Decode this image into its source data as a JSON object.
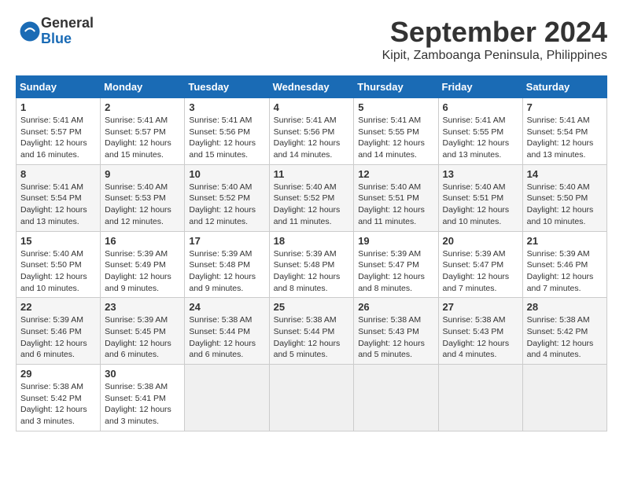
{
  "logo": {
    "general": "General",
    "blue": "Blue"
  },
  "title": "September 2024",
  "location": "Kipit, Zamboanga Peninsula, Philippines",
  "weekdays": [
    "Sunday",
    "Monday",
    "Tuesday",
    "Wednesday",
    "Thursday",
    "Friday",
    "Saturday"
  ],
  "weeks": [
    [
      {
        "day": "1",
        "sunrise": "5:41 AM",
        "sunset": "5:57 PM",
        "daylight": "12 hours and 16 minutes."
      },
      {
        "day": "2",
        "sunrise": "5:41 AM",
        "sunset": "5:57 PM",
        "daylight": "12 hours and 15 minutes."
      },
      {
        "day": "3",
        "sunrise": "5:41 AM",
        "sunset": "5:56 PM",
        "daylight": "12 hours and 15 minutes."
      },
      {
        "day": "4",
        "sunrise": "5:41 AM",
        "sunset": "5:56 PM",
        "daylight": "12 hours and 14 minutes."
      },
      {
        "day": "5",
        "sunrise": "5:41 AM",
        "sunset": "5:55 PM",
        "daylight": "12 hours and 14 minutes."
      },
      {
        "day": "6",
        "sunrise": "5:41 AM",
        "sunset": "5:55 PM",
        "daylight": "12 hours and 13 minutes."
      },
      {
        "day": "7",
        "sunrise": "5:41 AM",
        "sunset": "5:54 PM",
        "daylight": "12 hours and 13 minutes."
      }
    ],
    [
      {
        "day": "8",
        "sunrise": "5:41 AM",
        "sunset": "5:54 PM",
        "daylight": "12 hours and 13 minutes."
      },
      {
        "day": "9",
        "sunrise": "5:40 AM",
        "sunset": "5:53 PM",
        "daylight": "12 hours and 12 minutes."
      },
      {
        "day": "10",
        "sunrise": "5:40 AM",
        "sunset": "5:52 PM",
        "daylight": "12 hours and 12 minutes."
      },
      {
        "day": "11",
        "sunrise": "5:40 AM",
        "sunset": "5:52 PM",
        "daylight": "12 hours and 11 minutes."
      },
      {
        "day": "12",
        "sunrise": "5:40 AM",
        "sunset": "5:51 PM",
        "daylight": "12 hours and 11 minutes."
      },
      {
        "day": "13",
        "sunrise": "5:40 AM",
        "sunset": "5:51 PM",
        "daylight": "12 hours and 10 minutes."
      },
      {
        "day": "14",
        "sunrise": "5:40 AM",
        "sunset": "5:50 PM",
        "daylight": "12 hours and 10 minutes."
      }
    ],
    [
      {
        "day": "15",
        "sunrise": "5:40 AM",
        "sunset": "5:50 PM",
        "daylight": "12 hours and 10 minutes."
      },
      {
        "day": "16",
        "sunrise": "5:39 AM",
        "sunset": "5:49 PM",
        "daylight": "12 hours and 9 minutes."
      },
      {
        "day": "17",
        "sunrise": "5:39 AM",
        "sunset": "5:48 PM",
        "daylight": "12 hours and 9 minutes."
      },
      {
        "day": "18",
        "sunrise": "5:39 AM",
        "sunset": "5:48 PM",
        "daylight": "12 hours and 8 minutes."
      },
      {
        "day": "19",
        "sunrise": "5:39 AM",
        "sunset": "5:47 PM",
        "daylight": "12 hours and 8 minutes."
      },
      {
        "day": "20",
        "sunrise": "5:39 AM",
        "sunset": "5:47 PM",
        "daylight": "12 hours and 7 minutes."
      },
      {
        "day": "21",
        "sunrise": "5:39 AM",
        "sunset": "5:46 PM",
        "daylight": "12 hours and 7 minutes."
      }
    ],
    [
      {
        "day": "22",
        "sunrise": "5:39 AM",
        "sunset": "5:46 PM",
        "daylight": "12 hours and 6 minutes."
      },
      {
        "day": "23",
        "sunrise": "5:39 AM",
        "sunset": "5:45 PM",
        "daylight": "12 hours and 6 minutes."
      },
      {
        "day": "24",
        "sunrise": "5:38 AM",
        "sunset": "5:44 PM",
        "daylight": "12 hours and 6 minutes."
      },
      {
        "day": "25",
        "sunrise": "5:38 AM",
        "sunset": "5:44 PM",
        "daylight": "12 hours and 5 minutes."
      },
      {
        "day": "26",
        "sunrise": "5:38 AM",
        "sunset": "5:43 PM",
        "daylight": "12 hours and 5 minutes."
      },
      {
        "day": "27",
        "sunrise": "5:38 AM",
        "sunset": "5:43 PM",
        "daylight": "12 hours and 4 minutes."
      },
      {
        "day": "28",
        "sunrise": "5:38 AM",
        "sunset": "5:42 PM",
        "daylight": "12 hours and 4 minutes."
      }
    ],
    [
      {
        "day": "29",
        "sunrise": "5:38 AM",
        "sunset": "5:42 PM",
        "daylight": "12 hours and 3 minutes."
      },
      {
        "day": "30",
        "sunrise": "5:38 AM",
        "sunset": "5:41 PM",
        "daylight": "12 hours and 3 minutes."
      },
      null,
      null,
      null,
      null,
      null
    ]
  ],
  "labels": {
    "sunrise": "Sunrise:",
    "sunset": "Sunset:",
    "daylight": "Daylight:"
  }
}
